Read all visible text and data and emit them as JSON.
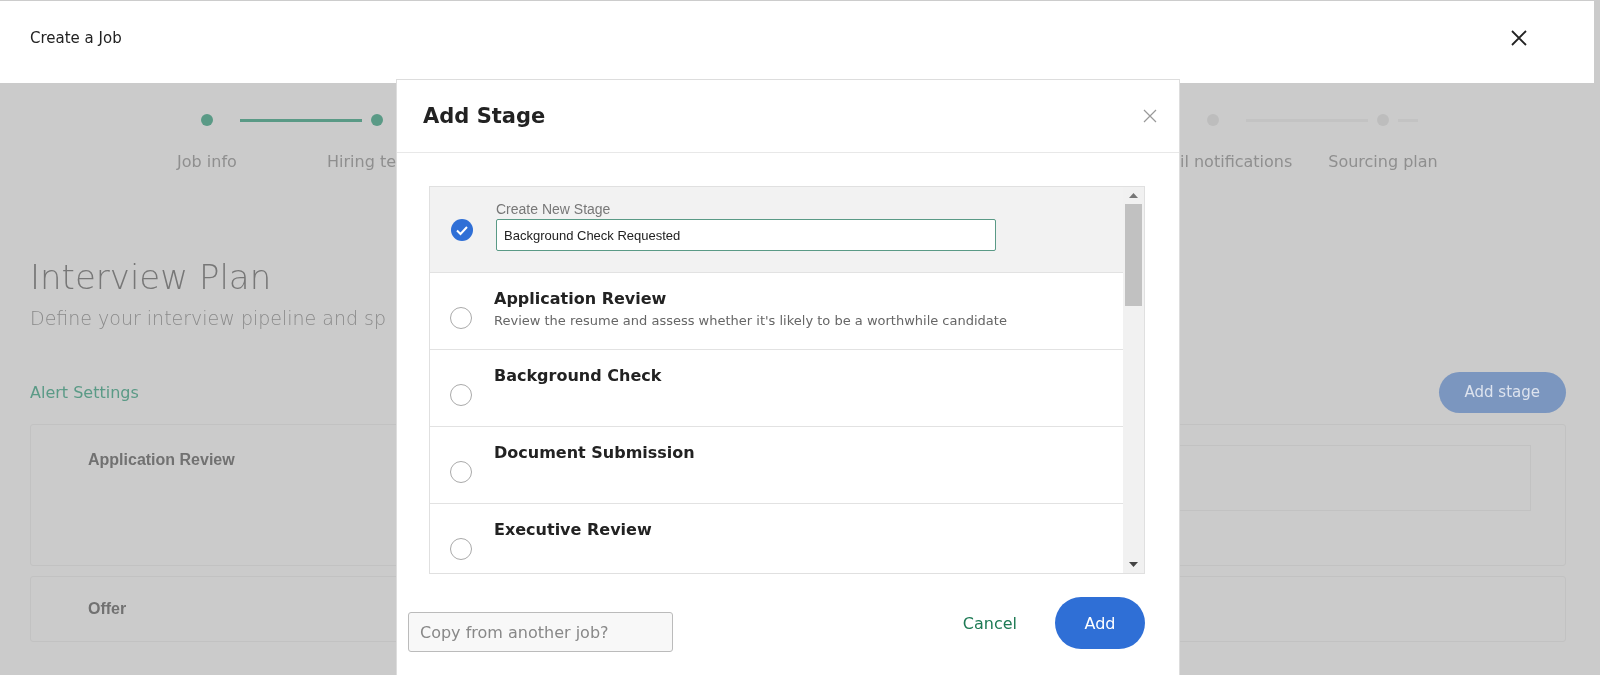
{
  "header": {
    "title": "Create a Job"
  },
  "stepper": [
    {
      "label": "Job info",
      "done": true
    },
    {
      "label": "Hiring te",
      "done": true
    },
    {
      "label": "il notifications",
      "done": false
    },
    {
      "label": "Sourcing plan",
      "done": false
    }
  ],
  "page": {
    "title": "Interview Plan",
    "subtitle": "Define your interview pipeline and sp",
    "alert_link": "Alert Settings",
    "add_button": "Add stage"
  },
  "stage_cards": [
    {
      "title": "Application Review"
    },
    {
      "title": "Offer"
    }
  ],
  "dialog": {
    "title": "Add Stage",
    "options": [
      {
        "kind": "new",
        "label": "Create New Stage",
        "value": "Background Check Requested",
        "selected": true
      },
      {
        "kind": "existing",
        "title": "Application Review",
        "description": "Review the resume and assess whether it's likely to be a worthwhile candidate",
        "selected": false
      },
      {
        "kind": "existing",
        "title": "Background Check",
        "selected": false
      },
      {
        "kind": "existing",
        "title": "Document Submission",
        "selected": false
      },
      {
        "kind": "existing",
        "title": "Executive Review",
        "selected": false
      }
    ],
    "copy_placeholder": "Copy from another job?",
    "cancel": "Cancel",
    "confirm": "Add"
  }
}
